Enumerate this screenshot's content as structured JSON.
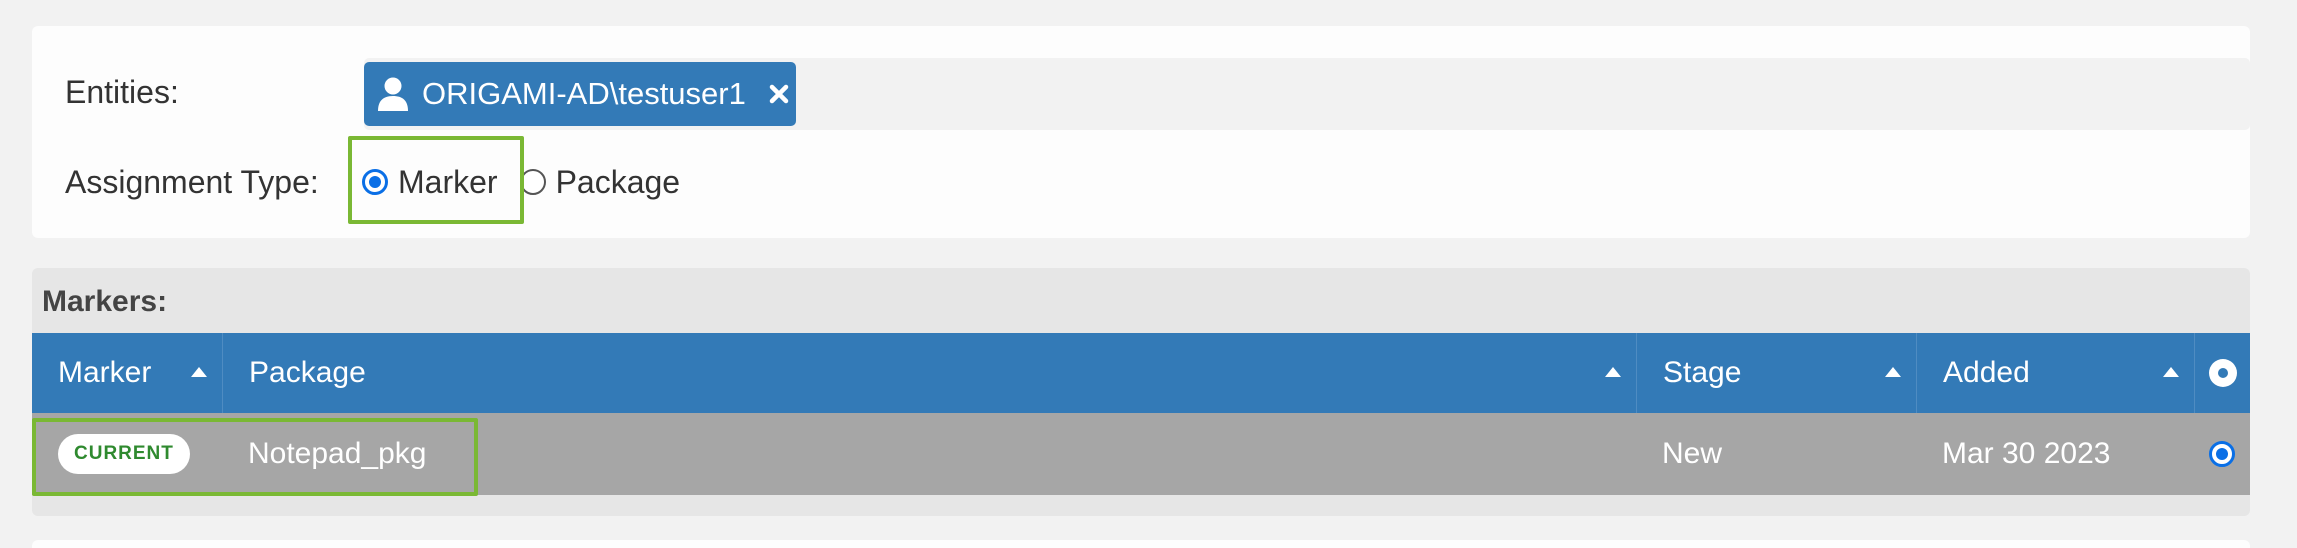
{
  "form": {
    "entities_label": "Entities:",
    "assignment_type_label": "Assignment Type:",
    "entity_chip": {
      "text": "ORIGAMI-AD\\testuser1",
      "icon": "user-icon",
      "remove_icon": "close-icon"
    },
    "assignment_options": [
      {
        "label": "Marker",
        "selected": true
      },
      {
        "label": "Package",
        "selected": false
      }
    ]
  },
  "markers": {
    "title": "Markers:",
    "columns": [
      {
        "label": "Marker",
        "sortable": true
      },
      {
        "label": "Package",
        "sortable": true
      },
      {
        "label": "Stage",
        "sortable": true
      },
      {
        "label": "Added",
        "sortable": true
      },
      {
        "label": "",
        "select_all_icon": "radio-icon"
      }
    ],
    "rows": [
      {
        "marker_badge": "CURRENT",
        "package": "Notepad_pkg",
        "stage": "New",
        "added": "Mar 30 2023",
        "selected": true
      }
    ]
  },
  "colors": {
    "header_blue": "#337ab7",
    "row_gray": "#a6a6a6",
    "highlight_green": "#7ab834",
    "badge_green": "#2f8a2f",
    "radio_blue": "#0a6fe6"
  }
}
